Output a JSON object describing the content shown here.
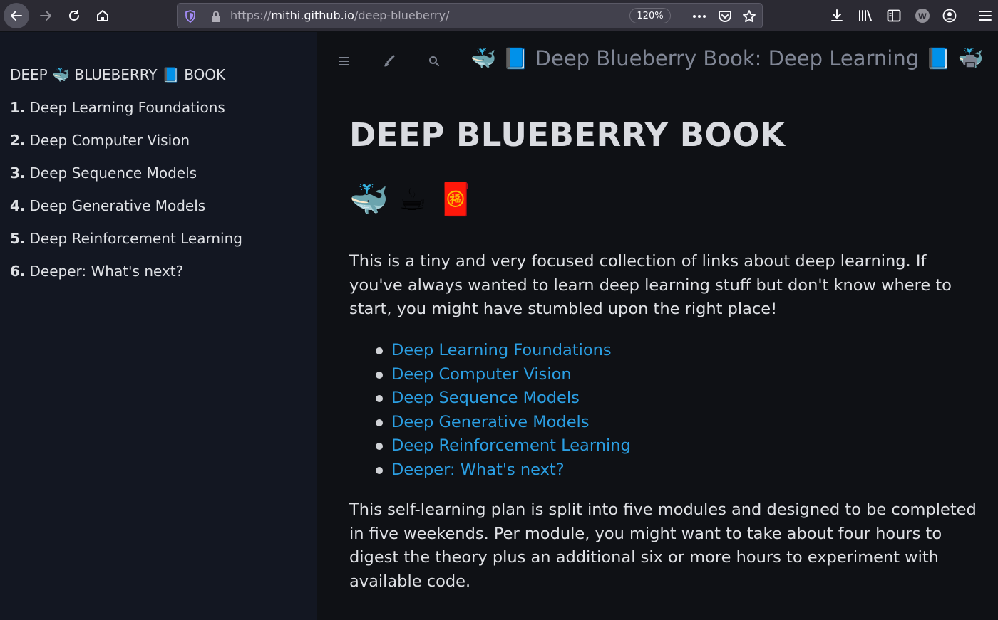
{
  "browser": {
    "url_prefix": "https://",
    "url_host": "mithi.github.io",
    "url_path": "/deep-blueberry/",
    "zoom": "120%",
    "extension_badge": "W",
    "icons": [
      "back-icon",
      "forward-icon",
      "reload-icon",
      "home-icon",
      "shield-icon",
      "lock-icon",
      "more-icon",
      "pocket-icon",
      "star-icon",
      "download-icon",
      "library-icon",
      "reader-icon",
      "extension-icon",
      "account-icon",
      "menu-icon"
    ]
  },
  "sidebar": {
    "title": "DEEP 🐳 BLUEBERRY 📘 BOOK",
    "items": [
      {
        "num": "1.",
        "label": "Deep Learning Foundations"
      },
      {
        "num": "2.",
        "label": "Deep Computer Vision"
      },
      {
        "num": "3.",
        "label": "Deep Sequence Models"
      },
      {
        "num": "4.",
        "label": "Deep Generative Models"
      },
      {
        "num": "5.",
        "label": "Deep Reinforcement Learning"
      },
      {
        "num": "6.",
        "label": "Deeper: What's next?"
      }
    ]
  },
  "menubar": {
    "title": "🐳 📘 Deep Blueberry Book: Deep Learning 📘 🐳"
  },
  "content": {
    "heading": "DEEP BLUEBERRY BOOK",
    "emojis": "🐳 ☕ 🧧",
    "intro": "This is a tiny and very focused collection of links about deep learning. If you've always wanted to learn deep learning stuff but don't know where to start, you might have stumbled upon the right place!",
    "links": [
      "Deep Learning Foundations",
      "Deep Computer Vision",
      "Deep Sequence Models",
      "Deep Generative Models",
      "Deep Reinforcement Learning",
      "Deeper: What's next?"
    ],
    "plan": "This self-learning plan is split into five modules and designed to be completed in five weekends. Per module, you might want to take about four hours to digest the theory plus an additional six or more hours to experiment with available code."
  },
  "colors": {
    "chrome": "#2b2a33",
    "sidebar_bg": "#131722",
    "content_bg": "#0f1115",
    "link": "#2b9fe3",
    "text": "#dfe1e5"
  }
}
